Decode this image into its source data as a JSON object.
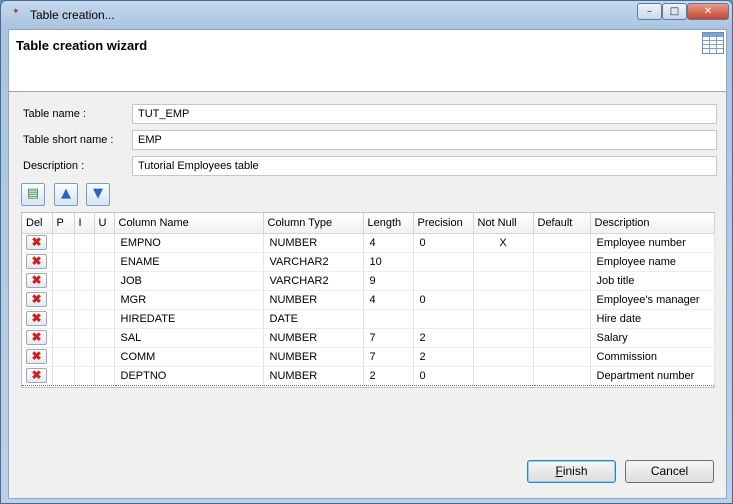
{
  "window": {
    "title": "Table creation...",
    "minimize_glyph": "–",
    "maximize_glyph": "□",
    "close_glyph": "✕"
  },
  "header": {
    "title": "Table creation wizard",
    "icon": "table-grid-icon"
  },
  "form": {
    "table_name_label": "Table name :",
    "table_name_value": "TUT_EMP",
    "short_name_label": "Table short name :",
    "short_name_value": "EMP",
    "description_label": "Description :",
    "description_value": "Tutorial Employees table"
  },
  "toolbar": {
    "add_icon": "add-column-icon",
    "up_icon": "move-up-icon",
    "down_icon": "move-down-icon",
    "add_glyph": "▤",
    "up_glyph": "▲",
    "down_glyph": "▼"
  },
  "grid": {
    "columns": [
      "Del",
      "P",
      "I",
      "U",
      "Column Name",
      "Column Type",
      "Length",
      "Precision",
      "Not Null",
      "Default",
      "Description"
    ],
    "delete_glyph": "✖",
    "rows": [
      {
        "name": "EMPNO",
        "type": "NUMBER",
        "length": "4",
        "precision": "0",
        "not_null": "X",
        "default": "",
        "description": "Employee number"
      },
      {
        "name": "ENAME",
        "type": "VARCHAR2",
        "length": "10",
        "precision": "",
        "not_null": "",
        "default": "",
        "description": "Employee name"
      },
      {
        "name": "JOB",
        "type": "VARCHAR2",
        "length": "9",
        "precision": "",
        "not_null": "",
        "default": "",
        "description": "Job title"
      },
      {
        "name": "MGR",
        "type": "NUMBER",
        "length": "4",
        "precision": "0",
        "not_null": "",
        "default": "",
        "description": "Employee's manager"
      },
      {
        "name": "HIREDATE",
        "type": "DATE",
        "length": "",
        "precision": "",
        "not_null": "",
        "default": "",
        "description": "Hire date"
      },
      {
        "name": "SAL",
        "type": "NUMBER",
        "length": "7",
        "precision": "2",
        "not_null": "",
        "default": "",
        "description": "Salary"
      },
      {
        "name": "COMM",
        "type": "NUMBER",
        "length": "7",
        "precision": "2",
        "not_null": "",
        "default": "",
        "description": "Commission"
      },
      {
        "name": "DEPTNO",
        "type": "NUMBER",
        "length": "2",
        "precision": "0",
        "not_null": "",
        "default": "",
        "description": "Department number"
      }
    ]
  },
  "buttons": {
    "finish_first": "F",
    "finish_rest": "inish",
    "cancel": "Cancel"
  }
}
